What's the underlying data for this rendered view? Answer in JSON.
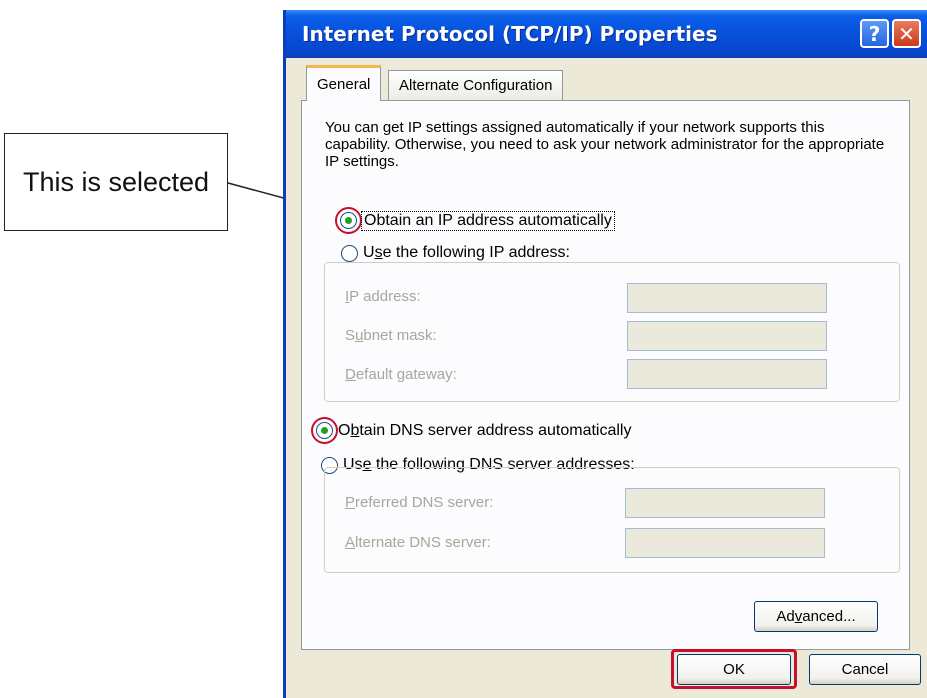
{
  "callout": {
    "text": "This is selected"
  },
  "window": {
    "title": "Internet Protocol (TCP/IP) Properties",
    "help_glyph": "?",
    "close_glyph": "✕"
  },
  "tabs": [
    {
      "label": "General",
      "active": true
    },
    {
      "label": "Alternate Configuration",
      "active": false
    }
  ],
  "general": {
    "intro": "You can get IP settings assigned automatically if your network supports this capability. Otherwise, you need to ask your network administrator for the appropriate IP settings.",
    "ip_auto": {
      "label": "Obtain an IP address automatically",
      "checked": true
    },
    "ip_manual": {
      "label_pre": "U",
      "label_u": "s",
      "label_post": "e the following IP address:",
      "checked": false
    },
    "ip_fields": [
      {
        "label_u": "I",
        "label": "P address:",
        "value": ""
      },
      {
        "label_pre": "S",
        "label_u": "u",
        "label": "bnet mask:",
        "value": ""
      },
      {
        "label_u": "D",
        "label": "efault gateway:",
        "value": ""
      }
    ],
    "dns_auto": {
      "label_pre": "O",
      "label_u": "b",
      "label_post": "tain DNS server address automatically",
      "checked": true
    },
    "dns_manual": {
      "label_pre": "Us",
      "label_u": "e",
      "label_post": " the following DNS server addresses:",
      "checked": false
    },
    "dns_fields": [
      {
        "label_u": "P",
        "label": "referred DNS server:",
        "value": ""
      },
      {
        "label_u": "A",
        "label": "lternate DNS server:",
        "value": ""
      }
    ],
    "advanced_pre": "Ad",
    "advanced_u": "v",
    "advanced_post": "anced..."
  },
  "buttons": {
    "ok": "OK",
    "cancel": "Cancel"
  },
  "colors": {
    "titlebar": "#0750dc",
    "highlight": "#c8102e",
    "dialog_bg": "#ece9d8",
    "radio_dot": "#21a121"
  }
}
